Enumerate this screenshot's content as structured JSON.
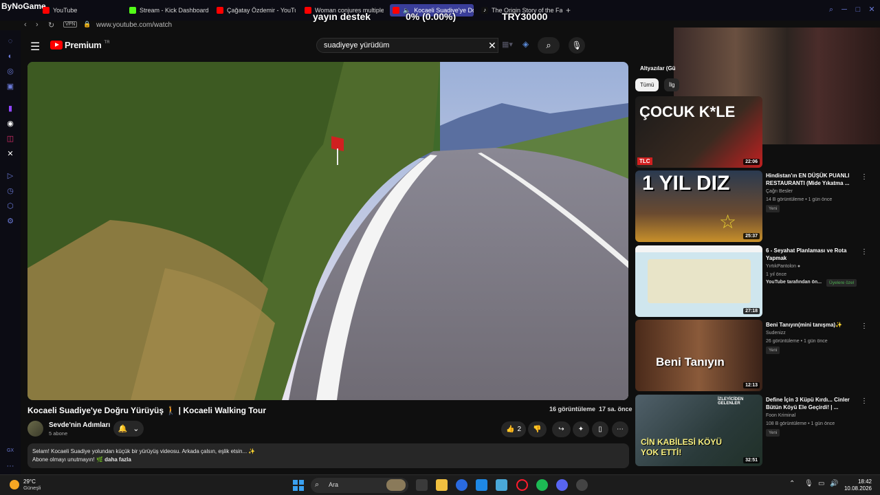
{
  "browser": {
    "brand": "ByNoGame",
    "tabs": [
      {
        "label": "YouTube",
        "color": "#ff0000"
      },
      {
        "label": "Stream - Kick Dashboard",
        "color": "#53fc18"
      },
      {
        "label": "Çağatay Özdemir - YouTub",
        "color": "#ff0000"
      },
      {
        "label": "Woman conjures multiple g",
        "color": "#ff0000"
      },
      {
        "label": "Kocaeli Suadiye'ye Do",
        "color": "#ff0000",
        "active": true
      },
      {
        "label": "The Origin Story of the Fam",
        "color": "#000000"
      }
    ],
    "new_tab": "+",
    "url": "www.youtube.com/watch",
    "vpn": "VPN"
  },
  "overlay": {
    "left": "yayın destek",
    "center": "0% (0.00%)",
    "right": "TRY30000"
  },
  "yt": {
    "logo": "Premium",
    "logo_sup": "TR",
    "search_value": "suadiyeye yürüdüm"
  },
  "video": {
    "title": "Kocaeli Suadiye'ye Doğru Yürüyüş 🚶 | Kocaeli Walking Tour",
    "views": "16 görüntüleme",
    "age": "17 sa. önce",
    "channel": "Sevde'nin Adımları",
    "subs": "5 abone",
    "likes": "2",
    "description_line1": "Selam! Kocaeli Suadiye yolundan küçük bir yürüyüş videosu. Arkada çalsın, eşlik etsin... ✨",
    "description_line2": "Abone olmayı unutmayın! 🌿",
    "more": "daha fazla"
  },
  "sidebar_recs": {
    "header": "Altyazılar (Gü",
    "chips": [
      {
        "label": "Tümü",
        "active": true
      },
      {
        "label": "İlg",
        "active": false
      }
    ],
    "items": [
      {
        "title": "",
        "channel": "",
        "meta": "",
        "badge": "",
        "duration": "22:06",
        "thumb_text": "ÇOCUK K*LE",
        "thumb_badge": "TLC"
      },
      {
        "title": "Hindistan'ın EN DÜŞÜK PUANLI RESTAURANTI (Mide Yıkatma ...",
        "channel": "Çağrı Besler",
        "meta": "14 B görüntüleme • 1 gün önce",
        "badge": "Yeni",
        "duration": "25:37",
        "thumb_text": "1 YIL DIZ"
      },
      {
        "title": "6 - Seyahat Planlaması ve Rota Yapmak",
        "channel": "YırtıkPantolon",
        "meta": "1 yıl önce",
        "badge": "YouTube tarafından ön...",
        "badge2": "Üyelere özel",
        "duration": "27:18",
        "thumb_text": ""
      },
      {
        "title": "Beni Tanıyın(mini tanışma)✨",
        "channel": "Sudenizz",
        "meta": "26 görüntüleme • 1 gün önce",
        "badge": "Yeni",
        "duration": "12:13",
        "thumb_text": "Beni Tanıyın"
      },
      {
        "title": "Define İçin 3 Küpü Kırdı... Cinler Bütün Köyü Ele Geçirdi! | ...",
        "channel": "Foon Kriminal",
        "meta": "108 B görüntüleme • 1 gün önce",
        "badge": "Yeni",
        "duration": "32:51",
        "thumb_text": "CİN KABİLESİ KÖYÜ YOK ETTİ!",
        "thumb_top": "İZLEYİCİDEN GELENLER"
      }
    ]
  },
  "taskbar": {
    "temp": "29°C",
    "weather": "Güneşli",
    "search": "Ara",
    "time": "18:42",
    "date": "10.08.2026"
  }
}
